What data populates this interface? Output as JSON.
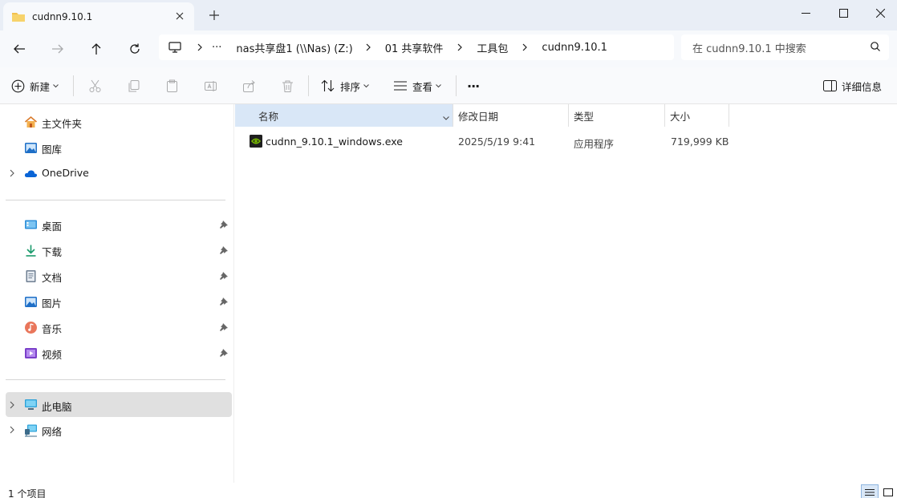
{
  "window": {
    "tab_title": "cudnn9.10.1",
    "controls": [
      "minimize-icon",
      "maximize-icon",
      "close-icon"
    ]
  },
  "address": {
    "overflow": "···",
    "crumbs": [
      "nas共享盘1 (\\\\Nas) (Z:)",
      "01 共享软件",
      "工具包",
      "cudnn9.10.1"
    ]
  },
  "search": {
    "placeholder": "在 cudnn9.10.1 中搜索"
  },
  "toolbar": {
    "new_label": "新建",
    "sort_label": "排序",
    "view_label": "查看",
    "more_label": "···",
    "details_label": "详细信息"
  },
  "sidebar": {
    "top": [
      {
        "label": "主文件夹",
        "icon": "home-icon"
      },
      {
        "label": "图库",
        "icon": "gallery-icon"
      },
      {
        "label": "OneDrive",
        "icon": "cloud-icon"
      }
    ],
    "pinned": [
      {
        "label": "桌面",
        "icon": "desktop-icon"
      },
      {
        "label": "下载",
        "icon": "download-icon"
      },
      {
        "label": "文档",
        "icon": "document-icon"
      },
      {
        "label": "图片",
        "icon": "pictures-icon"
      },
      {
        "label": "音乐",
        "icon": "music-icon"
      },
      {
        "label": "视频",
        "icon": "video-icon"
      }
    ],
    "bottom": [
      {
        "label": "此电脑",
        "icon": "computer-icon"
      },
      {
        "label": "网络",
        "icon": "network-icon"
      }
    ]
  },
  "columns": {
    "name": "名称",
    "modified": "修改日期",
    "type": "类型",
    "size": "大小"
  },
  "files": [
    {
      "name": "cudnn_9.10.1_windows.exe",
      "modified": "2025/5/19 9:41",
      "type": "应用程序",
      "size": "719,999 KB",
      "icon": "nvidia-exe-icon"
    }
  ],
  "status": {
    "item_count": "1 个项目"
  },
  "colors": {
    "accent": "#0067c0",
    "folder": "#f2c14e",
    "selected_header": "#d9e7f7"
  }
}
